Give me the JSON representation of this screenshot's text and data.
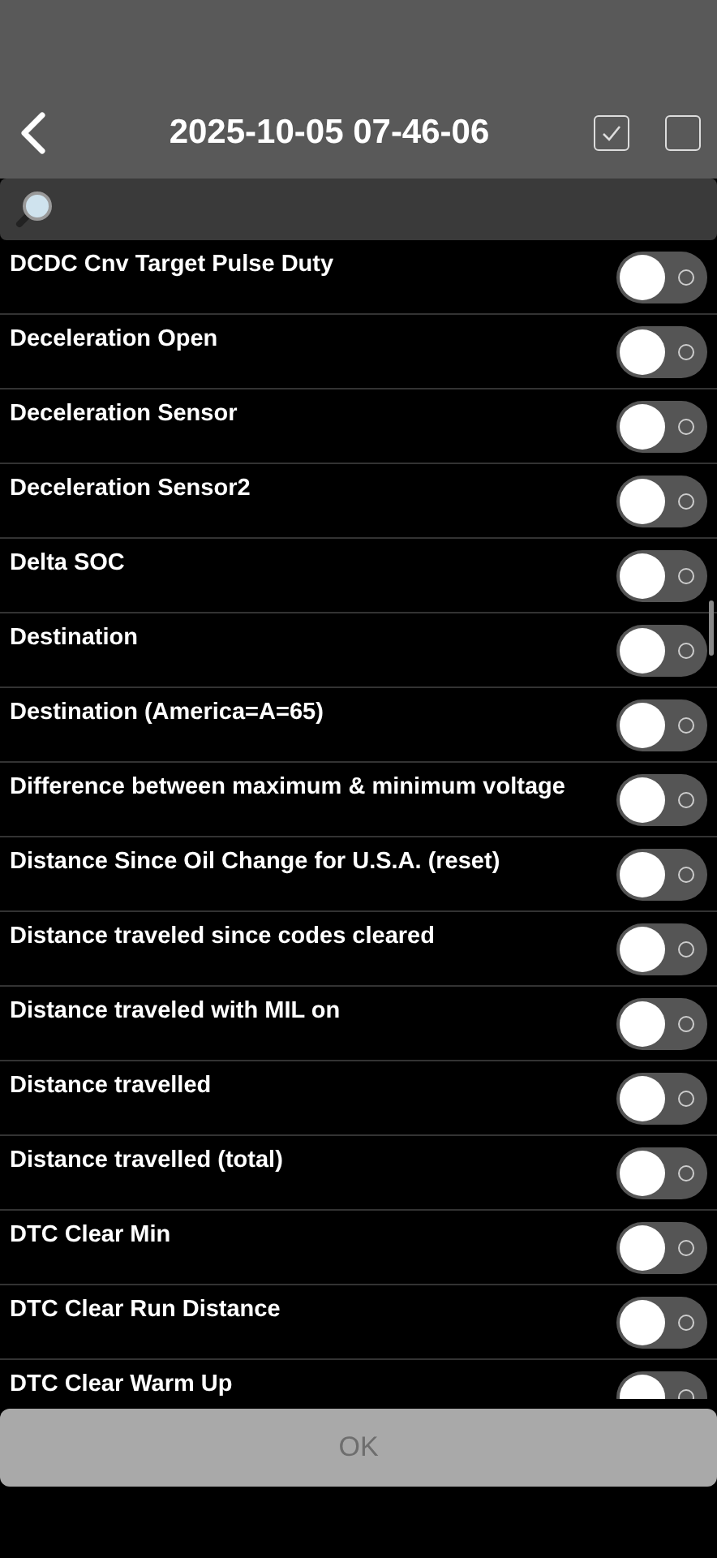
{
  "header": {
    "title": "2025-10-05 07-46-06",
    "select_all": {
      "checked": true
    },
    "select_none": {
      "checked": false
    }
  },
  "items": [
    {
      "label": "DCDC Cnv Target Pulse Duty",
      "on": false
    },
    {
      "label": "Deceleration Open",
      "on": false
    },
    {
      "label": "Deceleration Sensor",
      "on": false
    },
    {
      "label": "Deceleration Sensor2",
      "on": false
    },
    {
      "label": "Delta SOC",
      "on": false
    },
    {
      "label": "Destination",
      "on": false
    },
    {
      "label": "Destination (America=A=65)",
      "on": false
    },
    {
      "label": "Difference between maximum & minimum voltage",
      "on": false
    },
    {
      "label": "Distance Since Oil Change for U.S.A. (reset)",
      "on": false
    },
    {
      "label": "Distance traveled since codes cleared",
      "on": false
    },
    {
      "label": "Distance traveled with MIL on",
      "on": false
    },
    {
      "label": "Distance travelled",
      "on": false
    },
    {
      "label": "Distance travelled (total)",
      "on": false
    },
    {
      "label": "DTC Clear Min",
      "on": false
    },
    {
      "label": "DTC Clear Run Distance",
      "on": false
    },
    {
      "label": "DTC Clear Warm Up",
      "on": false
    }
  ],
  "ok_button": {
    "label": "OK",
    "disabled": true
  }
}
